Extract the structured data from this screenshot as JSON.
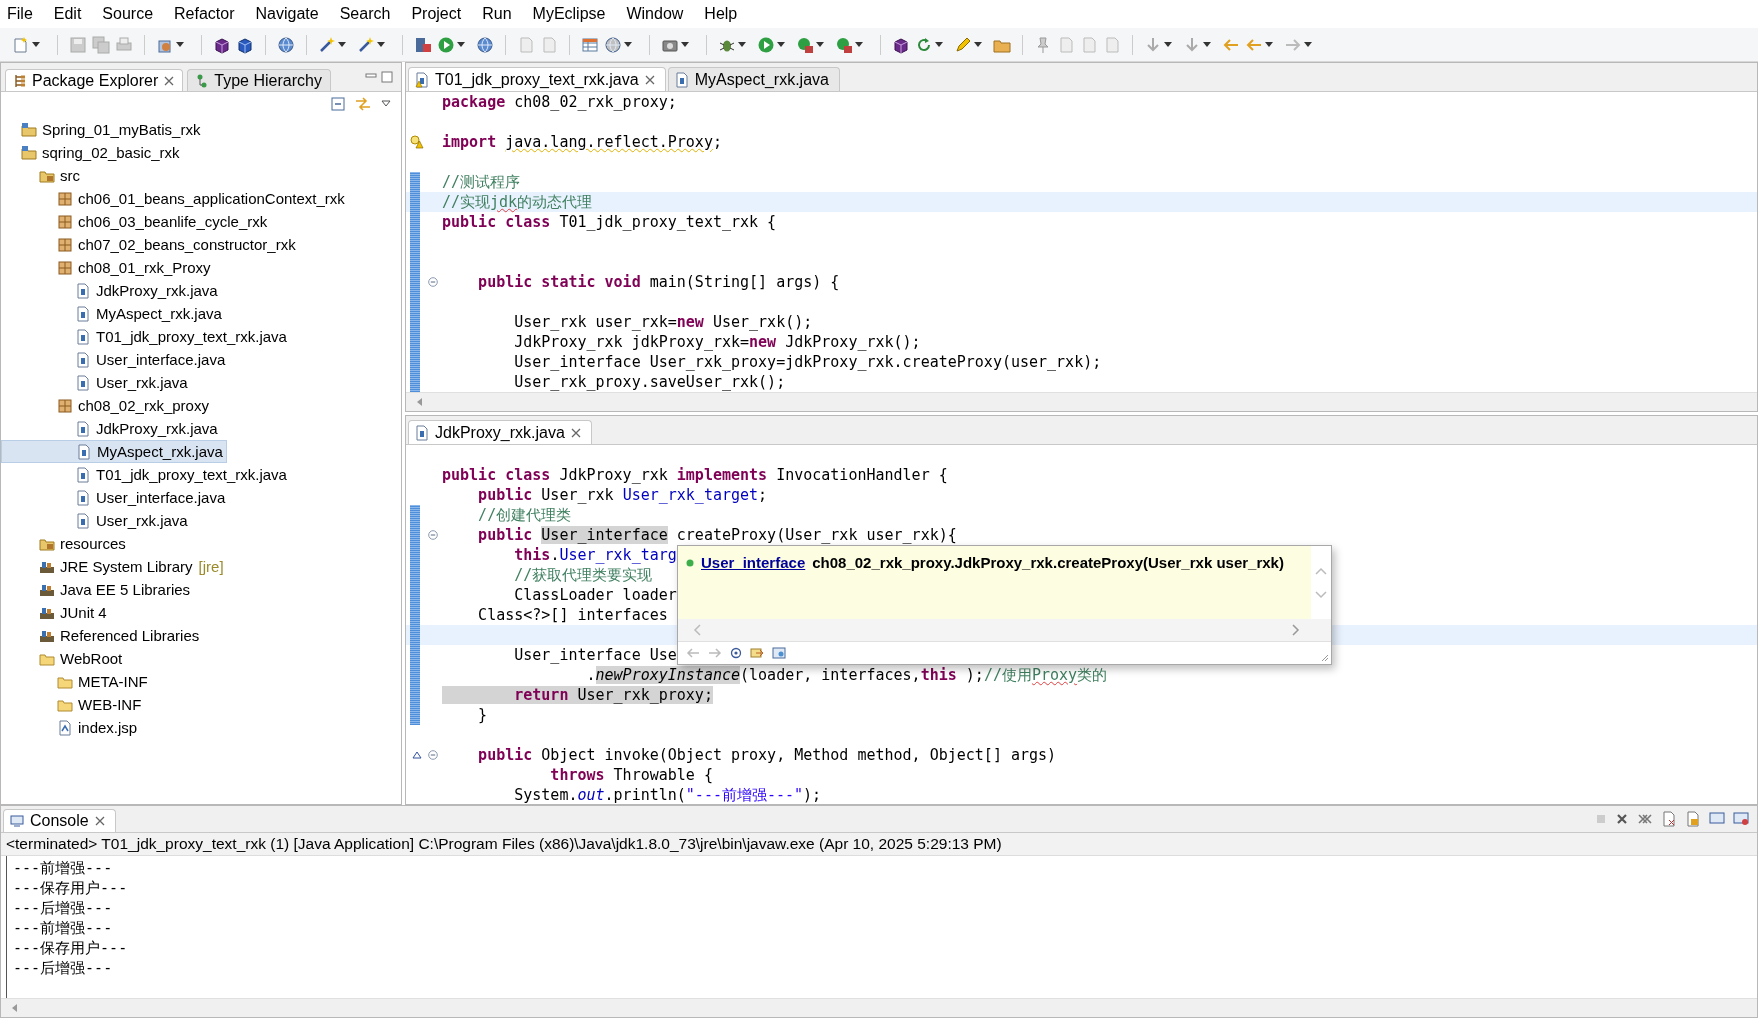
{
  "menu": [
    "File",
    "Edit",
    "Source",
    "Refactor",
    "Navigate",
    "Search",
    "Project",
    "Run",
    "MyEclipse",
    "Window",
    "Help"
  ],
  "explorer": {
    "tabs": [
      {
        "label": "Package Explorer",
        "selected": true
      },
      {
        "label": "Type Hierarchy",
        "selected": false
      }
    ],
    "tree": [
      {
        "label": "Spring_01_myBatis_rxk",
        "kind": "project",
        "selected": false
      },
      {
        "label": "sqring_02_basic_rxk",
        "kind": "project",
        "selected": false,
        "children": [
          {
            "label": "src",
            "kind": "source-folder",
            "selected": false,
            "children": [
              {
                "label": "ch06_01_beans_applicationContext_rxk",
                "kind": "package",
                "selected": false
              },
              {
                "label": "ch06_03_beanlife_cycle_rxk",
                "kind": "package",
                "selected": false
              },
              {
                "label": "ch07_02_beans_constructor_rxk",
                "kind": "package",
                "selected": false
              },
              {
                "label": "ch08_01_rxk_Proxy",
                "kind": "package",
                "selected": false,
                "children": [
                  {
                    "label": "JdkProxy_rxk.java",
                    "kind": "java",
                    "selected": false
                  },
                  {
                    "label": "MyAspect_rxk.java",
                    "kind": "java",
                    "selected": false
                  },
                  {
                    "label": "T01_jdk_proxy_text_rxk.java",
                    "kind": "java",
                    "selected": false
                  },
                  {
                    "label": "User_interface.java",
                    "kind": "java",
                    "selected": false
                  },
                  {
                    "label": "User_rxk.java",
                    "kind": "java",
                    "selected": false
                  }
                ]
              },
              {
                "label": "ch08_02_rxk_proxy",
                "kind": "package",
                "selected": false,
                "children": [
                  {
                    "label": "JdkProxy_rxk.java",
                    "kind": "java",
                    "selected": false
                  },
                  {
                    "label": "MyAspect_rxk.java",
                    "kind": "java",
                    "selected": true
                  },
                  {
                    "label": "T01_jdk_proxy_text_rxk.java",
                    "kind": "java",
                    "selected": false
                  },
                  {
                    "label": "User_interface.java",
                    "kind": "java",
                    "selected": false
                  },
                  {
                    "label": "User_rxk.java",
                    "kind": "java",
                    "selected": false
                  }
                ]
              }
            ]
          },
          {
            "label": "resources",
            "kind": "source-folder",
            "selected": false
          },
          {
            "label": "JRE System Library",
            "decoration": "[jre]",
            "kind": "library",
            "selected": false
          },
          {
            "label": "Java EE 5 Libraries",
            "kind": "library",
            "selected": false
          },
          {
            "label": "JUnit 4",
            "kind": "library",
            "selected": false
          },
          {
            "label": "Referenced Libraries",
            "kind": "library",
            "selected": false
          },
          {
            "label": "WebRoot",
            "kind": "folder",
            "selected": false,
            "children": [
              {
                "label": "META-INF",
                "kind": "folder",
                "selected": false
              },
              {
                "label": "WEB-INF",
                "kind": "folder",
                "selected": false
              },
              {
                "label": "index.jsp",
                "kind": "jsp",
                "selected": false
              }
            ]
          }
        ]
      }
    ]
  },
  "editors": [
    {
      "tabs": [
        {
          "label": "T01_jdk_proxy_text_rxk.java",
          "kind": "java-warning",
          "selected": true
        },
        {
          "label": "MyAspect_rxk.java",
          "kind": "java",
          "selected": false
        }
      ],
      "lines": [
        {
          "kind": "plain",
          "changed": false,
          "current": false,
          "segments": [
            {
              "kind": "keyword",
              "text": "package"
            },
            {
              "kind": "plain",
              "text": " ch08_02_rxk_proxy;"
            }
          ]
        },
        {
          "kind": "plain",
          "changed": false,
          "current": false
        },
        {
          "kind": "warning",
          "changed": false,
          "current": false,
          "segments": [
            {
              "kind": "keyword",
              "text": "import "
            },
            {
              "kind": "warning-squiggle",
              "text": "java.lang.reflect.Proxy"
            },
            {
              "kind": "plain",
              "text": ";"
            }
          ]
        },
        {
          "kind": "plain",
          "changed": false,
          "current": false
        },
        {
          "kind": "plain",
          "changed": true,
          "current": false,
          "segments": [
            {
              "kind": "comment",
              "text": "//测试程序"
            }
          ]
        },
        {
          "kind": "plain",
          "changed": true,
          "current": true,
          "segments": [
            {
              "kind": "comment",
              "text": "//实现"
            },
            {
              "kind": "comment-spell",
              "text": "jdk"
            },
            {
              "kind": "comment",
              "text": "的动态代理"
            }
          ]
        },
        {
          "kind": "plain",
          "changed": true,
          "current": false,
          "segments": [
            {
              "kind": "keyword",
              "text": "public class"
            },
            {
              "kind": "plain",
              "text": " T01_jdk_proxy_text_rxk {"
            }
          ]
        },
        {
          "kind": "plain",
          "changed": true,
          "current": false
        },
        {
          "kind": "plain",
          "changed": true,
          "current": false
        },
        {
          "kind": "fold",
          "changed": true,
          "current": false,
          "segments": [
            {
              "kind": "keyword",
              "text": "    public static void"
            },
            {
              "kind": "plain",
              "text": " main(String[] args) {"
            }
          ]
        },
        {
          "kind": "plain",
          "changed": true,
          "current": false
        },
        {
          "kind": "plain",
          "changed": true,
          "current": false,
          "segments": [
            {
              "kind": "plain",
              "text": "        User_rxk user_rxk="
            },
            {
              "kind": "keyword",
              "text": "new"
            },
            {
              "kind": "plain",
              "text": " User_rxk();"
            }
          ]
        },
        {
          "kind": "plain",
          "changed": true,
          "current": false,
          "segments": [
            {
              "kind": "plain",
              "text": "        JdkProxy_rxk jdkProxy_rxk="
            },
            {
              "kind": "keyword",
              "text": "new"
            },
            {
              "kind": "plain",
              "text": " JdkProxy_rxk();"
            }
          ]
        },
        {
          "kind": "plain",
          "changed": true,
          "current": false,
          "segments": [
            {
              "kind": "plain",
              "text": "        User_interface User_rxk_proxy=jdkProxy_rxk.createProxy(user_rxk);"
            }
          ]
        },
        {
          "kind": "plain",
          "changed": true,
          "current": false,
          "segments": [
            {
              "kind": "plain",
              "text": "        User_rxk_proxy.saveUser_rxk();"
            }
          ]
        }
      ]
    },
    {
      "tabs": [
        {
          "label": "JdkProxy_rxk.java",
          "kind": "java",
          "selected": true
        }
      ],
      "lines": [
        {
          "kind": "plain",
          "changed": false,
          "current": false
        },
        {
          "kind": "plain",
          "changed": false,
          "current": false,
          "segments": [
            {
              "kind": "keyword",
              "text": "public class"
            },
            {
              "kind": "plain",
              "text": " JdkProxy_rxk "
            },
            {
              "kind": "keyword",
              "text": "implements"
            },
            {
              "kind": "plain",
              "text": " InvocationHandler {"
            }
          ]
        },
        {
          "kind": "plain",
          "changed": false,
          "current": false,
          "segments": [
            {
              "kind": "keyword",
              "text": "    public"
            },
            {
              "kind": "plain",
              "text": " User_rxk "
            },
            {
              "kind": "field",
              "text": "User_rxk_target"
            },
            {
              "kind": "plain",
              "text": ";"
            }
          ]
        },
        {
          "kind": "plain",
          "changed": true,
          "current": false,
          "segments": [
            {
              "kind": "comment",
              "text": "    //创建代理类"
            }
          ]
        },
        {
          "kind": "fold",
          "changed": true,
          "current": false,
          "segments": [
            {
              "kind": "keyword",
              "text": "    public "
            },
            {
              "kind": "marked",
              "text": "User_interface"
            },
            {
              "kind": "plain",
              "text": " createProxy(User_rxk user_rxk){"
            }
          ]
        },
        {
          "kind": "plain",
          "changed": true,
          "current": false,
          "segments": [
            {
              "kind": "keyword",
              "text": "        this"
            },
            {
              "kind": "plain",
              "text": "."
            },
            {
              "kind": "field",
              "text": "User_rxk_targ"
            }
          ]
        },
        {
          "kind": "plain",
          "changed": true,
          "current": false,
          "segments": [
            {
              "kind": "comment",
              "text": "        //获取代理类要实现"
            }
          ]
        },
        {
          "kind": "plain",
          "changed": true,
          "current": false,
          "segments": [
            {
              "kind": "plain",
              "text": "        ClassLoader loader"
            }
          ]
        },
        {
          "kind": "plain",
          "changed": true,
          "current": false,
          "segments": [
            {
              "kind": "plain",
              "text": "    Class<?>[] interfaces"
            }
          ]
        },
        {
          "kind": "plain",
          "changed": true,
          "current": true
        },
        {
          "kind": "plain",
          "changed": true,
          "current": false,
          "segments": [
            {
              "kind": "plain",
              "text": "        User_interface Use"
            }
          ]
        },
        {
          "kind": "plain",
          "changed": true,
          "current": false,
          "segments": [
            {
              "kind": "plain",
              "text": "                ."
            },
            {
              "kind": "marked-italic",
              "text": "newProxyInstance"
            },
            {
              "kind": "plain",
              "text": "(loader, interfaces,"
            },
            {
              "kind": "keyword",
              "text": "this"
            },
            {
              "kind": "plain",
              "text": " );"
            },
            {
              "kind": "comment",
              "text": "//使用"
            },
            {
              "kind": "comment-spell",
              "text": "Proxy"
            },
            {
              "kind": "comment",
              "text": "类的"
            }
          ]
        },
        {
          "kind": "plain",
          "changed": true,
          "current": false,
          "segments": [
            {
              "kind": "marked-keyword",
              "text": "        return"
            },
            {
              "kind": "marked",
              "text": " User_rxk_proxy;"
            }
          ]
        },
        {
          "kind": "plain",
          "changed": true,
          "current": false,
          "segments": [
            {
              "kind": "plain",
              "text": "    }"
            }
          ]
        },
        {
          "kind": "plain",
          "changed": false,
          "current": false
        },
        {
          "kind": "override",
          "changed": false,
          "current": false,
          "segments": [
            {
              "kind": "keyword",
              "text": "    public"
            },
            {
              "kind": "plain",
              "text": " Object invoke(Object proxy, Method method, Object[] args)"
            }
          ]
        },
        {
          "kind": "plain",
          "changed": false,
          "current": false,
          "segments": [
            {
              "kind": "keyword",
              "text": "            throws"
            },
            {
              "kind": "plain",
              "text": " Throwable {"
            }
          ]
        },
        {
          "kind": "plain",
          "changed": false,
          "current": false,
          "segments": [
            {
              "kind": "plain",
              "text": "        System."
            },
            {
              "kind": "static-field",
              "text": "out"
            },
            {
              "kind": "plain",
              "text": ".println("
            },
            {
              "kind": "string",
              "text": "\"---前增强---\""
            },
            {
              "kind": "plain",
              "text": ");"
            }
          ]
        }
      ],
      "popup": {
        "link": "User_interface",
        "signature": "ch08_02_rxk_proxy.JdkProxy_rxk.createProxy(User_rxk user_rxk)"
      }
    }
  ],
  "console": {
    "tab": "Console",
    "header": "<terminated> T01_jdk_proxy_text_rxk (1) [Java Application] C:\\Program Files (x86)\\Java\\jdk1.8.0_73\\jre\\bin\\javaw.exe (Apr 10, 2025 5:29:13 PM)",
    "output": [
      "---前增强---",
      "---保存用户---",
      "---后增强---",
      "---前增强---",
      "---保存用户---",
      "---后增强---"
    ]
  }
}
